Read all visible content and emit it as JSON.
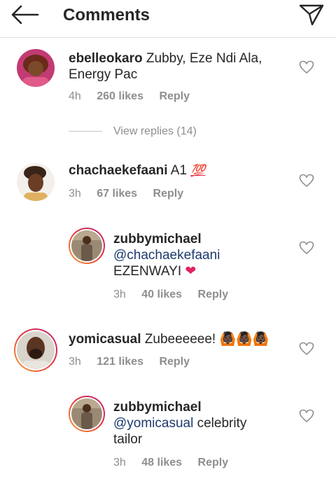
{
  "header": {
    "title": "Comments"
  },
  "icons": {
    "back": "back-arrow-icon",
    "send": "send-icon",
    "like": "heart-outline-icon"
  },
  "colors": {
    "text": "#262626",
    "muted": "#8e8e8e",
    "mention": "#1e3a6e",
    "heart_emoji": "#e0245e"
  },
  "comments": [
    {
      "username": "ebelleokaro",
      "text_line1": "Zubby, Eze Ndi Ala,",
      "text_line2": "Energy Pac",
      "time": "4h",
      "likes": "260 likes",
      "reply": "Reply",
      "view_replies": "View replies (14)"
    },
    {
      "username": "chachaekefaani",
      "text": "A1",
      "emoji": "💯",
      "time": "3h",
      "likes": "67 likes",
      "reply": "Reply",
      "replies": [
        {
          "username": "zubbymichael",
          "mention": "@chachaekefaani",
          "text": "EZENWAYI",
          "emoji": "❤",
          "time": "3h",
          "likes": "40 likes",
          "reply": "Reply"
        }
      ]
    },
    {
      "username": "yomicasual",
      "text": "Zubeeeeee!",
      "emoji": "🙆🏿🙆🏿🙆🏿",
      "time": "3h",
      "likes": "121 likes",
      "reply": "Reply",
      "replies": [
        {
          "username": "zubbymichael",
          "mention": "@yomicasual",
          "text_line1": "celebrity",
          "text_line2": "tailor",
          "time": "3h",
          "likes": "48 likes",
          "reply": "Reply"
        }
      ]
    }
  ]
}
